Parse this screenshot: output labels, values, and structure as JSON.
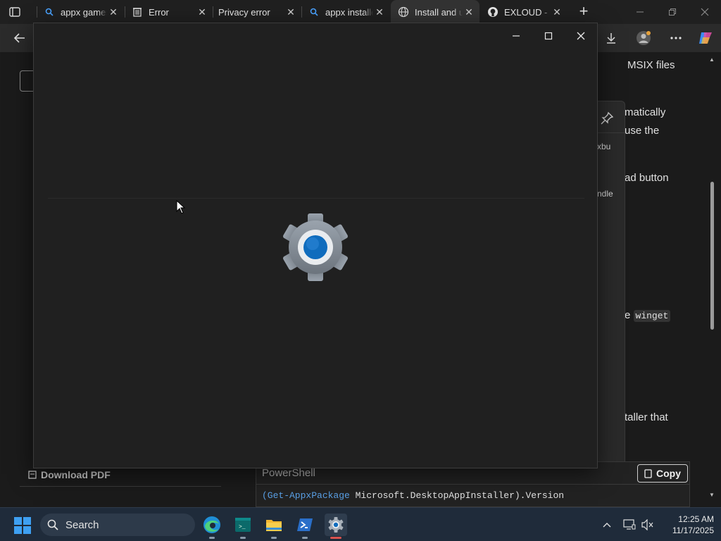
{
  "browser": {
    "tabs": [
      {
        "title": "appx games",
        "icon": "search-icon"
      },
      {
        "title": "Error",
        "icon": "trash-icon"
      },
      {
        "title": "Privacy error",
        "icon": "none"
      },
      {
        "title": "appx installer",
        "icon": "search-icon"
      },
      {
        "title": "Install and update",
        "icon": "globe-icon",
        "active": true
      },
      {
        "title": "EXLOUD - GitHub",
        "icon": "github-icon"
      }
    ],
    "new_tab_label": "+",
    "toolbar_icons": [
      "back-icon",
      "download-icon",
      "profile-icon",
      "more-icon",
      "copilot-icon"
    ]
  },
  "page": {
    "download_pdf": "Download PDF",
    "article_fragments": [
      "MSIX files",
      "matically",
      "use the",
      "ad button",
      "e",
      "winget",
      "taller that"
    ],
    "side_panel_fragments": [
      "xbu",
      "ndle"
    ],
    "code_block": {
      "language": "PowerShell",
      "copy_label": "Copy",
      "code_kw": "(Get-AppxPackage",
      "code_rest": " Microsoft.DesktopAppInstaller).Version"
    }
  },
  "settings_window": {
    "state": "loading",
    "splash_icon": "settings-gear-icon"
  },
  "taskbar": {
    "search_label": "Search",
    "apps": [
      "edge-icon",
      "terminal-icon",
      "file-explorer-icon",
      "powershell-icon",
      "settings-icon"
    ],
    "time": "12:25 AM",
    "date": "11/17/2025"
  },
  "colors": {
    "accent_blue": "#0f6cbd",
    "taskbar": "#1f2b3a",
    "window_bg": "#202020"
  }
}
